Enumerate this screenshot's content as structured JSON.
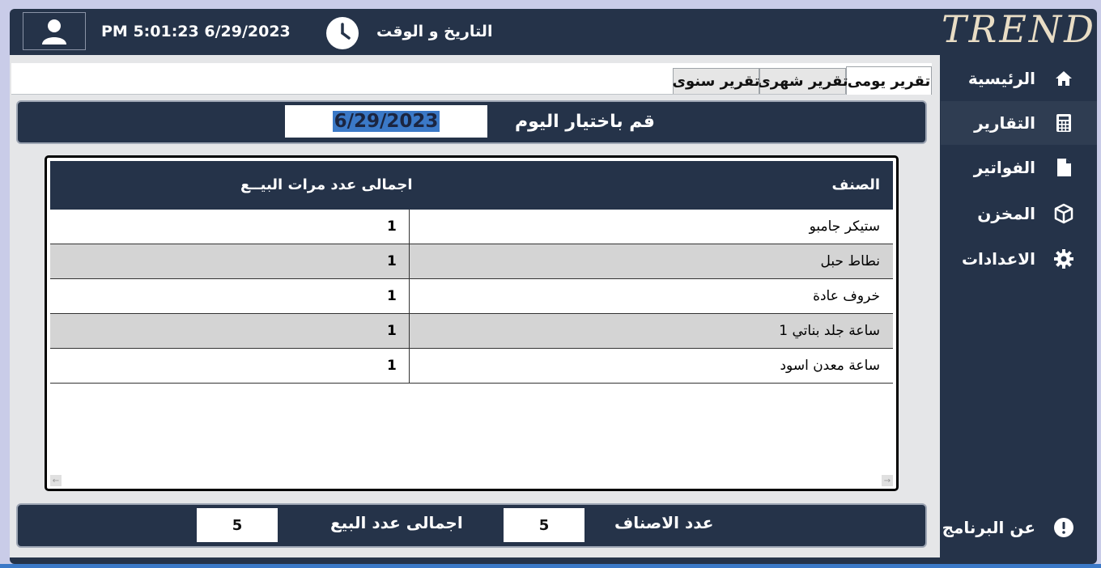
{
  "header": {
    "datetime": "PM 5:01:23 6/29/2023",
    "datetime_label": "التاريخ و الوقت",
    "logo_text": "TREND"
  },
  "tabs": [
    {
      "label": "تقرير يومى",
      "active": true
    },
    {
      "label": "تقرير شهرى",
      "active": false
    },
    {
      "label": "تقرير سنوى",
      "active": false
    }
  ],
  "date_panel": {
    "label": "قم باختيار اليوم",
    "value": "6/29/2023"
  },
  "table": {
    "columns": [
      "الصنف",
      "اجمالى عدد مرات البيــع"
    ],
    "rows": [
      {
        "name": "ستيكر جامبو",
        "count": "1"
      },
      {
        "name": "نطاط حبل",
        "count": "1"
      },
      {
        "name": "خروف عادة",
        "count": "1"
      },
      {
        "name": "ساعة جلد بناتي 1",
        "count": "1"
      },
      {
        "name": "ساعة معدن اسود",
        "count": "1"
      }
    ]
  },
  "summary": {
    "items_label": "عدد الاصناف",
    "items_value": "5",
    "sales_label": "اجمالى عدد البيع",
    "sales_value": "5"
  },
  "sidebar": {
    "items": [
      {
        "label": "الرئيسية",
        "icon": "home-icon"
      },
      {
        "label": "التقارير",
        "icon": "calculator-icon"
      },
      {
        "label": "الفواتير",
        "icon": "file-icon"
      },
      {
        "label": "المخزن",
        "icon": "box-icon"
      },
      {
        "label": "الاعدادات",
        "icon": "gear-icon"
      }
    ],
    "about_label": "عن البرنامج"
  },
  "colors": {
    "dark": "#253349",
    "accent": "#3b79c7",
    "row_alt": "#d4d4d4"
  }
}
